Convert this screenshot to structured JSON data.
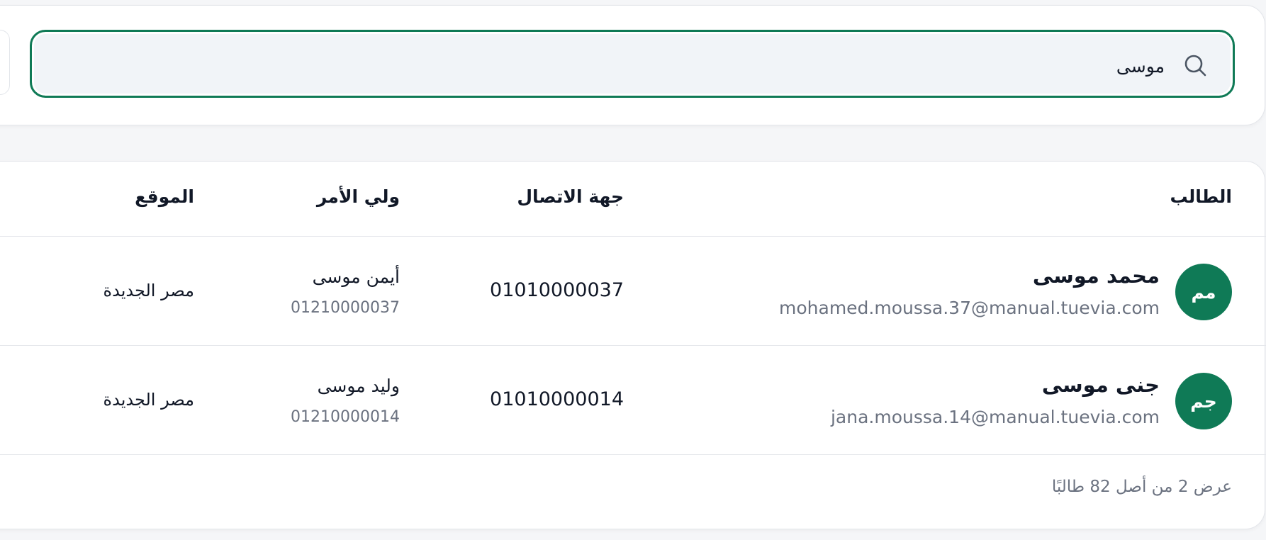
{
  "search": {
    "value": "موسى",
    "icon": "search-icon"
  },
  "table": {
    "headers": {
      "student": "الطالب",
      "contact": "جهة الاتصال",
      "guardian": "ولي الأمر",
      "location": "الموقع"
    },
    "rows": [
      {
        "initials": "مم",
        "name": "محمد موسى",
        "email": "mohamed.moussa.37@manual.tuevia.com",
        "contact": "01010000037",
        "guardian_name": "أيمن موسى",
        "guardian_phone": "01210000037",
        "location": "مصر الجديدة"
      },
      {
        "initials": "جم",
        "name": "جنى موسى",
        "email": "jana.moussa.14@manual.tuevia.com",
        "contact": "01010000014",
        "guardian_name": "وليد موسى",
        "guardian_phone": "01210000014",
        "location": "مصر الجديدة"
      }
    ],
    "footer": "عرض 2 من أصل 82 طالبًا"
  },
  "colors": {
    "accent": "#0f7a56",
    "muted_text": "#6b7280",
    "search_bg": "#f1f4f8"
  }
}
